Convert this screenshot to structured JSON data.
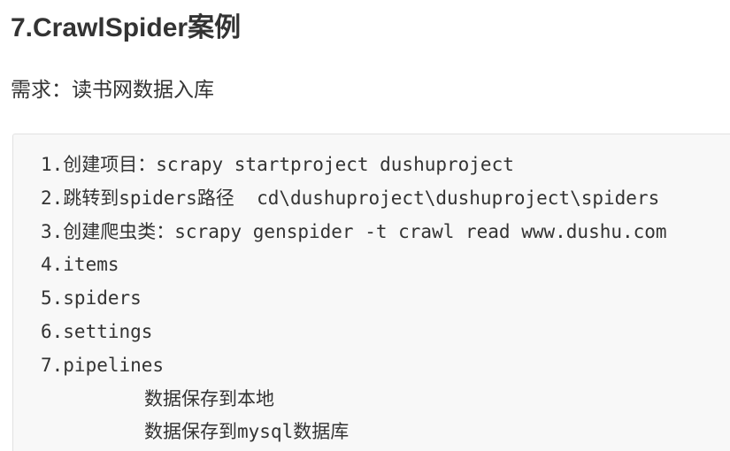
{
  "heading": "7.CrawlSpider案例",
  "requirement": "需求：读书网数据入库",
  "code_lines": [
    "1.创建项目：scrapy startproject dushuproject",
    "2.跳转到spiders路径  cd\\dushuproject\\dushuproject\\spiders",
    "3.创建爬虫类：scrapy genspider -t crawl read www.dushu.com",
    "4.items",
    "5.spiders",
    "6.settings",
    "7.pipelines",
    "数据保存到本地",
    "数据保存到mysql数据库"
  ]
}
